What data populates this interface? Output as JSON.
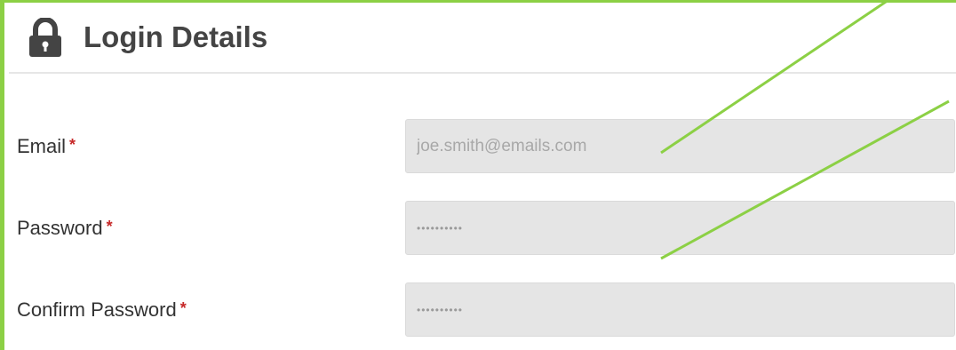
{
  "header": {
    "icon": "lock-icon",
    "title": "Login Details"
  },
  "form": {
    "required_marker": "*",
    "email": {
      "label": "Email",
      "value": "joe.smith@emails.com"
    },
    "password": {
      "label": "Password",
      "value": "••••••••••"
    },
    "confirm_password": {
      "label": "Confirm Password",
      "value": "••••••••••"
    }
  },
  "colors": {
    "frame_accent": "#8cd045",
    "required": "#c62828",
    "field_background": "#e5e5e5"
  }
}
